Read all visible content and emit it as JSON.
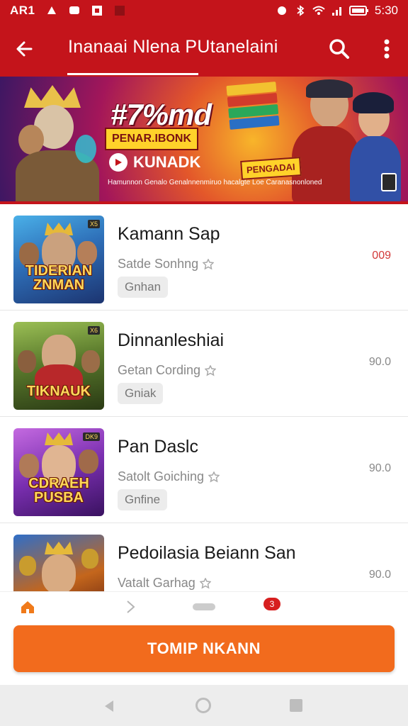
{
  "status_bar": {
    "left_label": "AR1",
    "time": "5:30"
  },
  "app_bar": {
    "title": "Inanaai Nlena PUtanelaini",
    "back_icon": "arrow-left-icon",
    "search_icon": "search-icon",
    "more_icon": "more-vertical-icon"
  },
  "banner": {
    "headline": "#7%md",
    "tag": "PENAR.IBONK",
    "brand": "KUNADK",
    "small_text": "Hamunnon Genalo Genalnnenmiruo hacalgte Loe Caranasnonloned",
    "right_badge": "PENGADAI"
  },
  "colors": {
    "primary": "#c4141b",
    "cta": "#f26b1d",
    "badge": "#d71f1f"
  },
  "games": [
    {
      "name": "Kamann Sap",
      "sub": "Satde Sonhng",
      "chip": "Gnhan",
      "price": "009",
      "price_accent": true,
      "thumb_title": "TIDERIAN ZNMAN",
      "thumb_badge": "X5"
    },
    {
      "name": "Dinnanleshiai",
      "sub": "Getan Cording",
      "chip": "Gniak",
      "price": "90.0",
      "price_accent": false,
      "thumb_title": "TIKNAUK",
      "thumb_badge": "X6"
    },
    {
      "name": "Pan Daslc",
      "sub": "Satolt Goiching",
      "chip": "Gnfine",
      "price": "90.0",
      "price_accent": false,
      "thumb_title": "CDRAEH PUSBA",
      "thumb_badge": "DK9"
    },
    {
      "name": "Pedoilasia Beiann San",
      "sub": "Vatalt Garhag",
      "chip": "",
      "price": "90.0",
      "price_accent": false,
      "thumb_title": "",
      "thumb_badge": ""
    }
  ],
  "tabs": {
    "badge_count": "3"
  },
  "cta": {
    "label": "TOMIP NKANN"
  }
}
